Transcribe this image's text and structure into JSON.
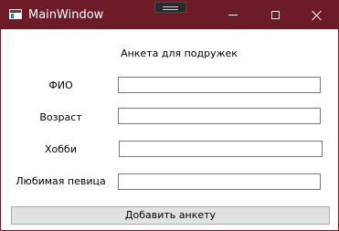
{
  "window": {
    "title": "MainWindow",
    "controls": {
      "minimize": "minimize-icon",
      "maximize": "maximize-icon",
      "close": "close-icon"
    }
  },
  "form": {
    "heading": "Анкета для подружек",
    "fields": [
      {
        "label": "ФИО",
        "value": ""
      },
      {
        "label": "Возраст",
        "value": ""
      },
      {
        "label": "Хобби",
        "value": ""
      },
      {
        "label": "Любимая певица",
        "value": ""
      }
    ],
    "submit_label": "Добавить анкету"
  },
  "colors": {
    "titlebar": "#6d1b27",
    "button_bg": "#e1e1e1"
  }
}
